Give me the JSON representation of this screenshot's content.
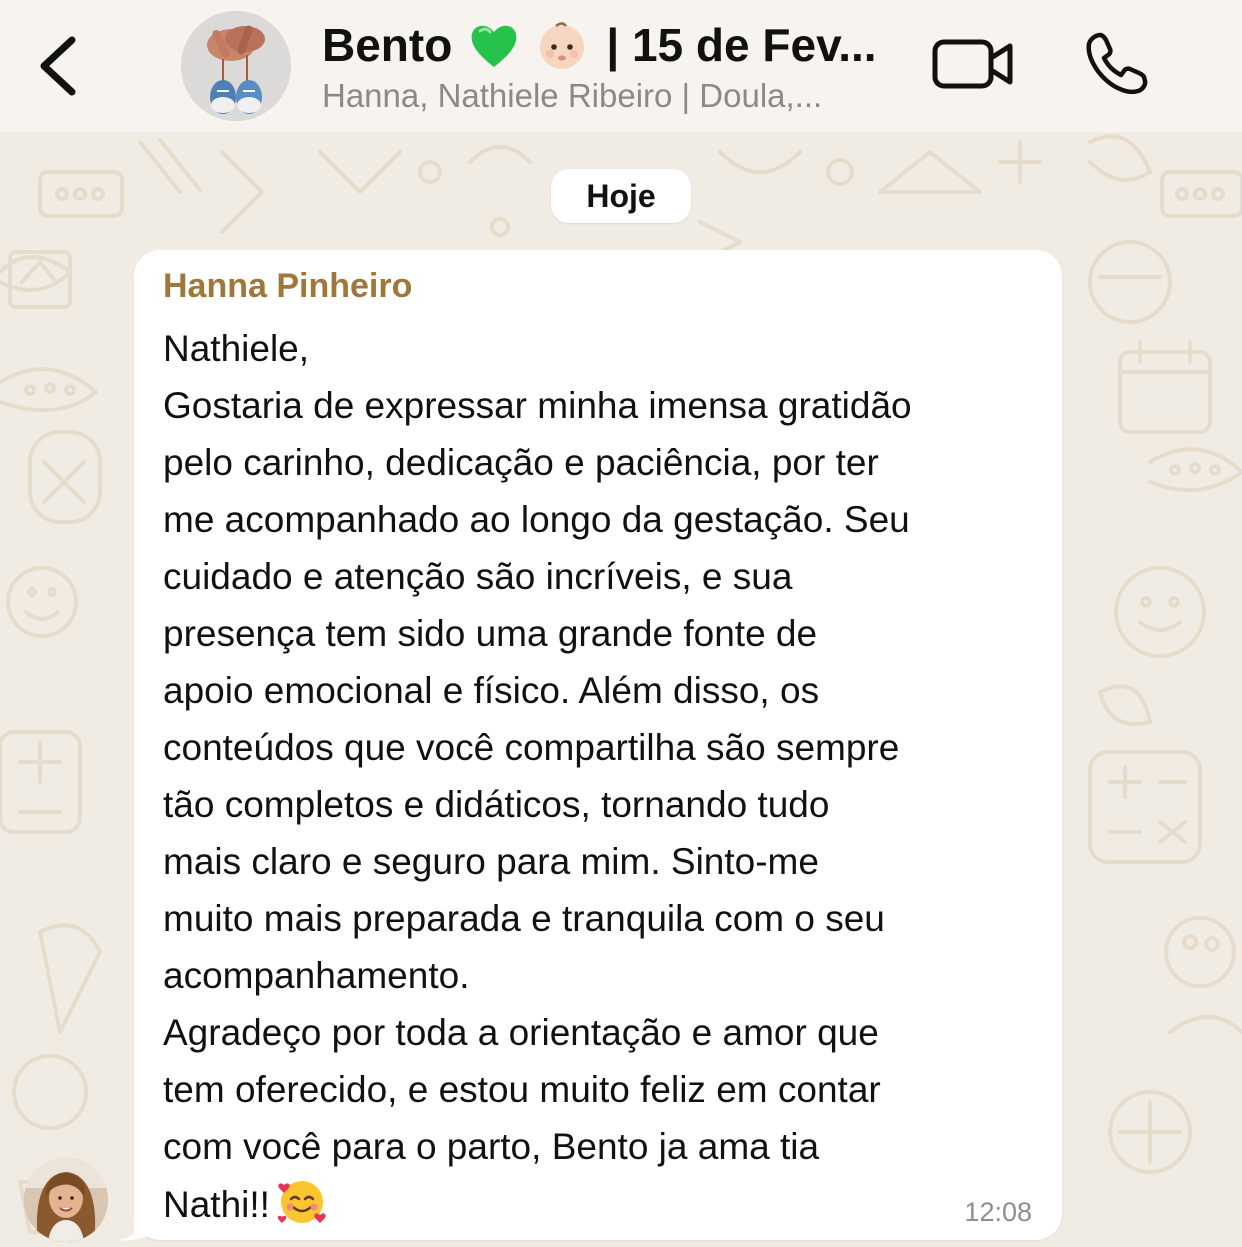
{
  "header": {
    "title": "Bento 💚👶🏼 | 15 de Fev...",
    "title_main": "Bento",
    "title_suffix": "| 15 de Fev...",
    "subtitle": "Hanna, Nathiele Ribeiro | Doula,...",
    "back_icon": "chevron-left-icon",
    "video_icon": "video-camera-icon",
    "call_icon": "phone-icon"
  },
  "chat": {
    "date_label": "Hoje",
    "message": {
      "sender": "Hanna Pinheiro",
      "lines": [
        "Nathiele,",
        "Gostaria de expressar minha imensa gratidão",
        "pelo carinho, dedicação e paciência, por ter",
        "me acompanhado ao longo da gestação. Seu",
        "cuidado e atenção são incríveis, e sua",
        "presença tem sido uma grande fonte de",
        "apoio emocional e físico. Além disso, os",
        "conteúdos que você compartilha são sempre",
        "tão completos e didáticos, tornando tudo",
        "mais claro e seguro para mim. Sinto-me",
        "muito mais preparada e tranquila com o seu",
        "acompanhamento.",
        "Agradeço por toda a orientação e amor que",
        "tem oferecido, e estou muito feliz em contar",
        "com você para o parto, Bento ja ama tia",
        "Nathi!!"
      ],
      "emoji": "smiling-face-with-hearts",
      "time": "12:08"
    }
  },
  "colors": {
    "header_bg": "#f7f4ef",
    "chat_bg": "#f1ece3",
    "bubble_bg": "#ffffff",
    "sender_name": "#a0773a",
    "subtitle": "#8a8a8a",
    "timestamp": "#8e8e8e"
  }
}
